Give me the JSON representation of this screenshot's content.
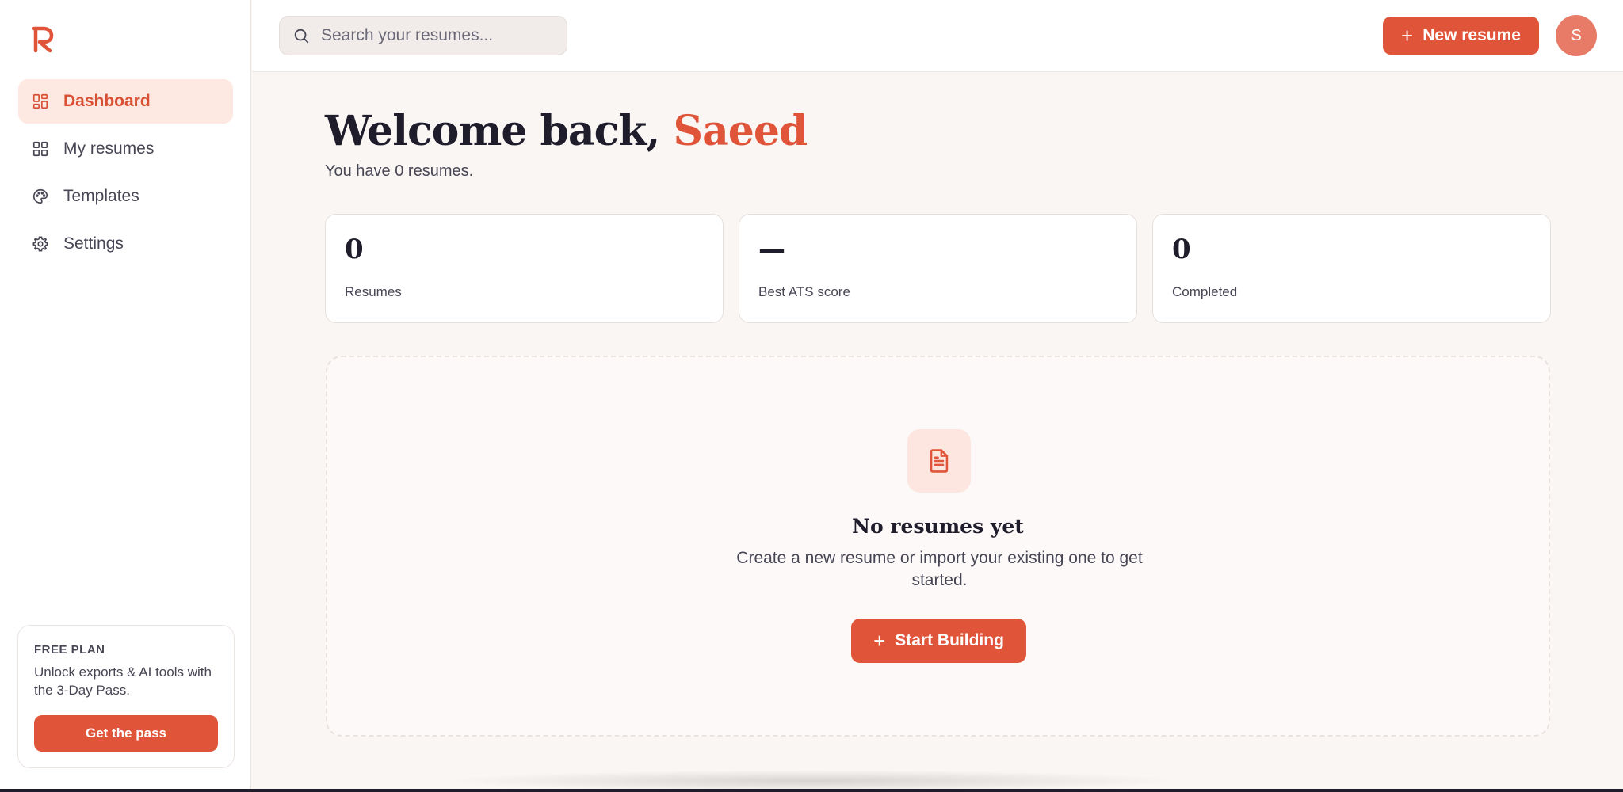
{
  "brand": {
    "logo_letter": "R",
    "accent": "#e0553a"
  },
  "sidebar": {
    "items": [
      {
        "label": "Dashboard",
        "icon": "dashboard-icon",
        "active": true
      },
      {
        "label": "My resumes",
        "icon": "grid-icon",
        "active": false
      },
      {
        "label": "Templates",
        "icon": "palette-icon",
        "active": false
      },
      {
        "label": "Settings",
        "icon": "gear-icon",
        "active": false
      }
    ],
    "plan": {
      "title": "FREE PLAN",
      "description": "Unlock exports & AI tools with the 3-Day Pass.",
      "button": "Get the pass"
    }
  },
  "topbar": {
    "search_placeholder": "Search your resumes...",
    "new_button": "New resume",
    "avatar_initial": "S"
  },
  "main": {
    "welcome_prefix": "Welcome back, ",
    "user_name": "Saeed",
    "subtitle": "You have 0 resumes.",
    "stats": [
      {
        "value": "0",
        "label": "Resumes"
      },
      {
        "value": "—",
        "label": "Best ATS score"
      },
      {
        "value": "0",
        "label": "Completed"
      }
    ],
    "empty": {
      "title": "No resumes yet",
      "description": "Create a new resume or import your existing one to get started.",
      "button": "Start Building"
    }
  }
}
